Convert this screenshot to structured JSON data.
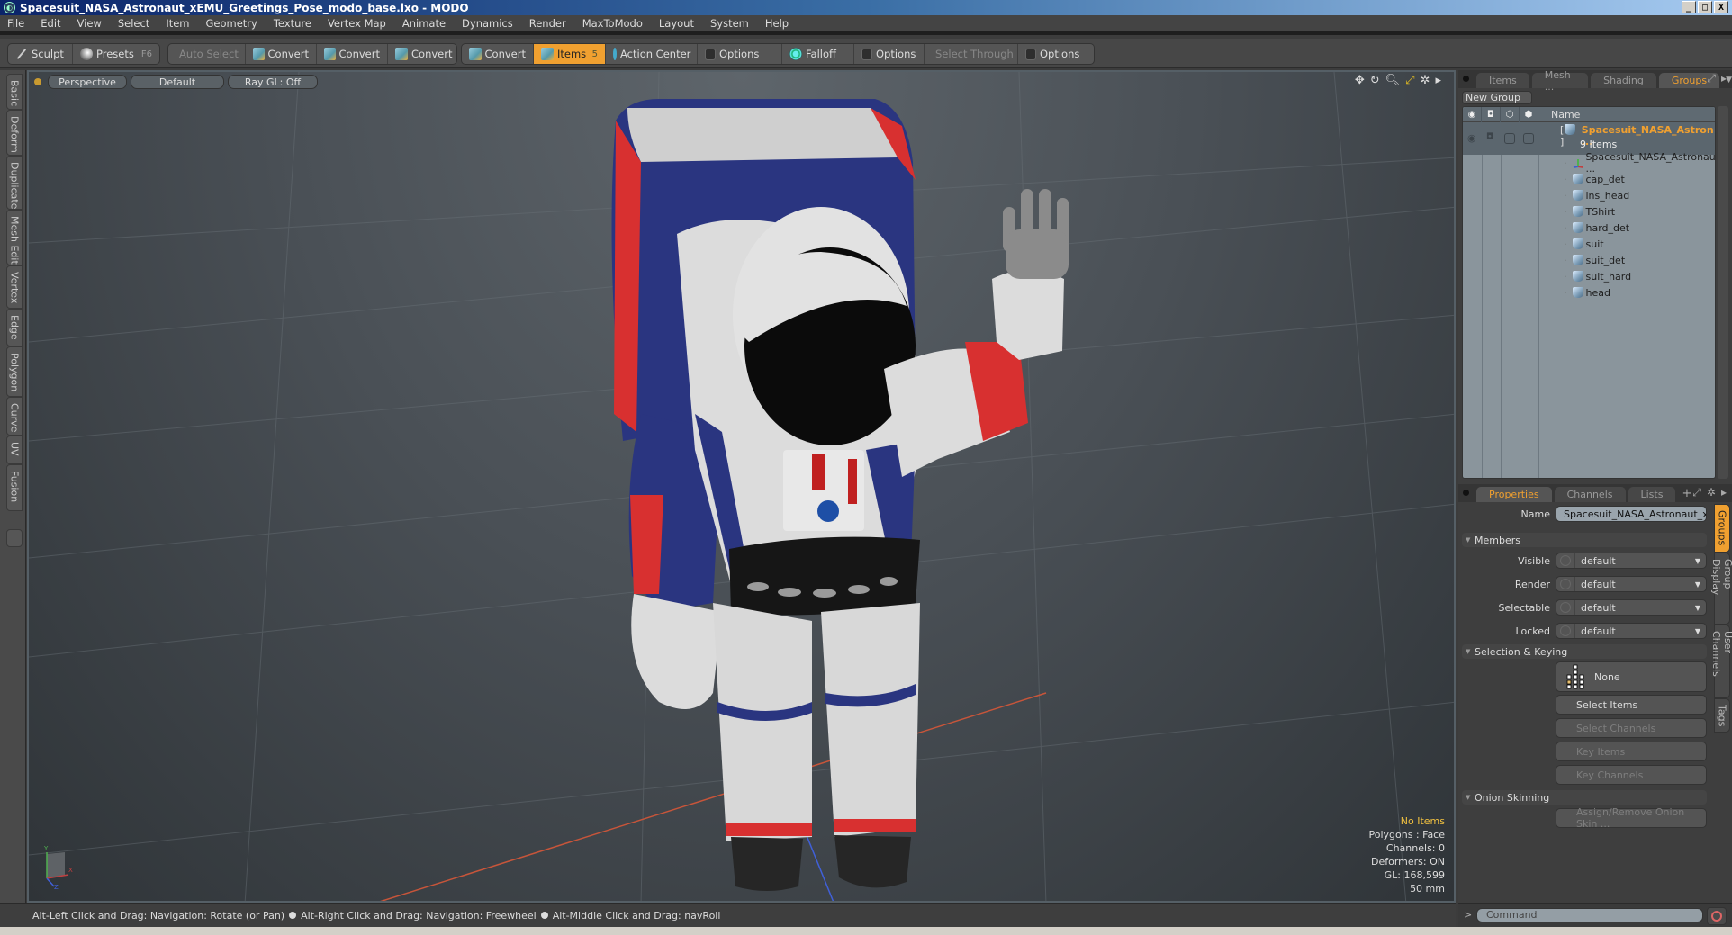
{
  "window": {
    "title": "Spacesuit_NASA_Astronaut_xEMU_Greetings_Pose_modo_base.lxo - MODO",
    "controls": [
      "minimize",
      "maximize",
      "close"
    ]
  },
  "menu": [
    "File",
    "Edit",
    "View",
    "Select",
    "Item",
    "Geometry",
    "Texture",
    "Vertex Map",
    "Animate",
    "Dynamics",
    "Render",
    "MaxToModo",
    "Layout",
    "System",
    "Help"
  ],
  "toolbar": {
    "sculpt": "Sculpt",
    "presets": "Presets",
    "presets_shortcut": "F6",
    "auto_select": "Auto Select",
    "convert1": "Convert",
    "convert2": "Convert",
    "convert3": "Convert",
    "convert4": "Convert",
    "items": "Items",
    "items_shortcut": "5",
    "action_center": "Action Center",
    "options1": "Options",
    "falloff": "Falloff",
    "options2": "Options",
    "select_through": "Select Through",
    "options3": "Options"
  },
  "left_tabs": [
    "Basic",
    "Deform",
    "Duplicate",
    "Mesh Edit",
    "Vertex",
    "Edge",
    "Polygon",
    "Curve",
    "UV",
    "Fusion"
  ],
  "viewport": {
    "view": "Perspective",
    "shading": "Default",
    "raygl": "Ray GL: Off",
    "hud": {
      "selection": "No Items",
      "mode": "Polygons : Face",
      "channels": "Channels: 0",
      "deformers": "Deformers: ON",
      "gl": "GL: 168,599",
      "focal": "50 mm"
    },
    "axis_labels": {
      "x": "X",
      "y": "Y",
      "z": "Z"
    }
  },
  "status": {
    "hint1": "Alt-Left Click and Drag: Navigation: Rotate (or Pan)",
    "hint2": "Alt-Right Click and Drag: Navigation: Freewheel",
    "hint3": "Alt-Middle Click and Drag: navRoll"
  },
  "groups_panel": {
    "tabs": [
      "Items",
      "Mesh ...",
      "Shading",
      "Groups"
    ],
    "active_tab": "Groups",
    "new_group": "New Group",
    "column_name": "Name",
    "group": {
      "name": "Spacesuit_NASA_Astron ...",
      "count": "9 Items"
    },
    "items": [
      {
        "name": "Spacesuit_NASA_Astronau ...",
        "type": "locator"
      },
      {
        "name": "cap_det",
        "type": "mesh"
      },
      {
        "name": "ins_head",
        "type": "mesh"
      },
      {
        "name": "TShirt",
        "type": "mesh"
      },
      {
        "name": "hard_det",
        "type": "mesh"
      },
      {
        "name": "suit",
        "type": "mesh"
      },
      {
        "name": "suit_det",
        "type": "mesh"
      },
      {
        "name": "suit_hard",
        "type": "mesh"
      },
      {
        "name": "head",
        "type": "mesh"
      }
    ]
  },
  "properties_panel": {
    "tabs": [
      "Properties",
      "Channels",
      "Lists",
      "+"
    ],
    "active_tab": "Properties",
    "name_label": "Name",
    "name_value": "Spacesuit_NASA_Astronaut_xEMU",
    "members_section": "Members",
    "visible_label": "Visible",
    "visible_value": "default",
    "render_label": "Render",
    "render_value": "default",
    "selectable_label": "Selectable",
    "selectable_value": "default",
    "locked_label": "Locked",
    "locked_value": "default",
    "selkey_section": "Selection & Keying",
    "none_btn": "None",
    "select_items": "Select Items",
    "select_channels": "Select Channels",
    "key_items": "Key Items",
    "key_channels": "Key Channels",
    "onion_section": "Onion Skinning",
    "onion_btn": "Assign/Remove Onion Skin ...",
    "side_tabs": [
      "Groups",
      "Group Display",
      "User Channels",
      "Tags"
    ]
  },
  "command": {
    "prompt": ">",
    "placeholder": "Command"
  },
  "colors": {
    "accent": "#f0a030",
    "titlebar_start": "#0b246a",
    "hud_highlight": "#f0c040"
  }
}
